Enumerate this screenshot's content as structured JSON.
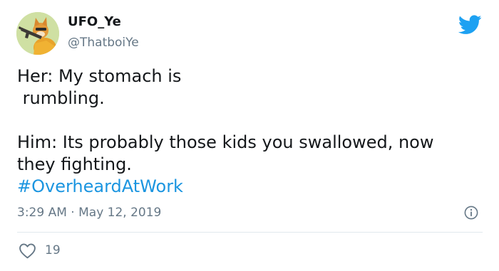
{
  "user": {
    "display_name": "UFO_Ye",
    "handle": "@ThatboiYe",
    "avatar_icon": "cartoon-fox-avatar-icon"
  },
  "tweet": {
    "lines": [
      "Her: My stomach is",
      " rumbling.",
      "",
      "Him: Its probably those kids you swallowed, now",
      "they fighting."
    ],
    "hashtag": "#OverheardAtWork",
    "time": "3:29 AM",
    "separator": "·",
    "date": "May 12, 2019",
    "like_count": "19"
  },
  "icons": {
    "brand": "twitter-bird-icon",
    "info": "info-icon",
    "like": "heart-icon"
  },
  "colors": {
    "brand_blue": "#1da1f2",
    "hashtag_blue": "#1b95e0",
    "text": "#14171a",
    "secondary": "#657786",
    "divider": "#e1e8ed"
  }
}
